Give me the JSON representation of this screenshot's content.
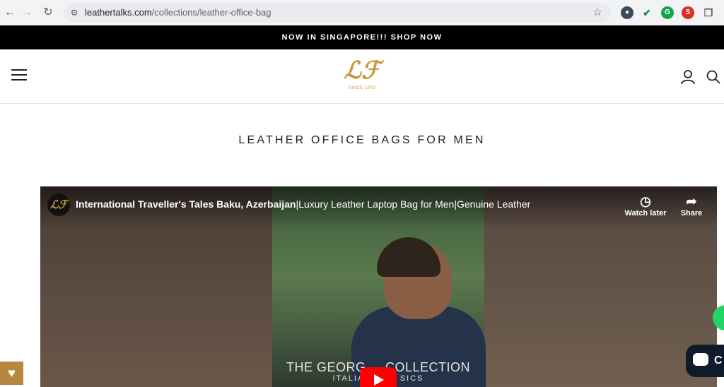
{
  "browser": {
    "url_host": "leathertalks.com",
    "url_path": "/collections/leather-office-bag",
    "back_icon": "back-arrow-icon",
    "forward_icon": "forward-arrow-icon",
    "reload_icon": "reload-icon",
    "bookmark_icon": "star-icon"
  },
  "announcement": {
    "text": "NOW IN SINGAPORE!!! SHOP NOW"
  },
  "header": {
    "logo_mark": "ℒℱ",
    "logo_tagline": "SINCE 1973"
  },
  "page": {
    "title": "LEATHER OFFICE BAGS FOR MEN"
  },
  "video": {
    "channel_initials": "ℒℱ",
    "title_bold": "International Traveller's Tales Baku, Azerbaijan",
    "title_rest": "|Luxury Leather Laptop Bag for Men|Genuine Leather",
    "watch_later": "Watch later",
    "share": "Share",
    "overlay_title": "THE GEORG     COLLECTION",
    "overlay_sub": "ITALIA          SICS"
  },
  "widgets": {
    "chat_text": "C"
  },
  "colors": {
    "brand_gold": "#c49a3c",
    "announcement_bg": "#000000",
    "wishlist_bg": "#b8873f"
  }
}
